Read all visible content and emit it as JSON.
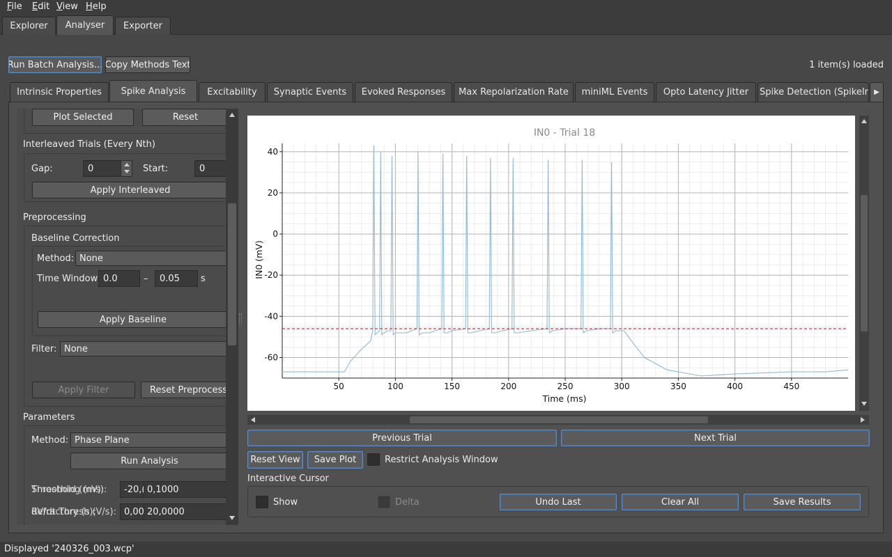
{
  "menu": {
    "items": [
      {
        "label": "File",
        "u": "F",
        "rest": "ile"
      },
      {
        "label": "Edit",
        "u": "E",
        "rest": "dit"
      },
      {
        "label": "View",
        "u": "V",
        "rest": "iew"
      },
      {
        "label": "Help",
        "u": "H",
        "rest": "elp"
      }
    ]
  },
  "top_tabs": [
    "Explorer",
    "Analyser",
    "Exporter"
  ],
  "top_tabs_active": "Analyser",
  "toolbar": {
    "run_batch": "Run Batch Analysis...",
    "copy_methods": "Copy Methods Text",
    "items_loaded": "1 item(s) loaded"
  },
  "sub_tabs": [
    "Intrinsic Properties",
    "Spike Analysis",
    "Excitability",
    "Synaptic Events",
    "Evoked Responses",
    "Max Repolarization Rate",
    "miniML Events",
    "Opto Latency Jitter",
    "Spike Detection (SpikeInt"
  ],
  "sub_tabs_active": "Spike Analysis",
  "left": {
    "plot_selected": "Plot Selected",
    "reset": "Reset",
    "interleaved_title": "Interleaved Trials (Every Nth)",
    "gap_label": "Gap:",
    "gap_value": "0",
    "start_label": "Start:",
    "start_value": "0",
    "apply_interleaved": "Apply Interleaved",
    "preprocessing_title": "Preprocessing",
    "baseline_title": "Baseline Correction",
    "method_label": "Method:",
    "method_value": "None",
    "time_window_label": "Time Window:",
    "tw_start": "0.0",
    "tw_dash": "–",
    "tw_end": "0.05",
    "tw_unit": "s",
    "apply_baseline": "Apply Baseline",
    "filter_label": "Filter:",
    "filter_value": "None",
    "apply_filter": "Apply Filter",
    "reset_preprocessing": "Reset Preprocessi",
    "parameters_title": "Parameters",
    "param_method_label": "Method:",
    "param_method_value": "Phase Plane",
    "run_analysis": "Run Analysis",
    "row1_label_a": "Smoothing (ms):",
    "row1_label_b": "Threshold (mV):",
    "row1_val_a": "-20,(",
    "row1_val_b": "0,1000",
    "row2_label_a": "dV/dt Thresh (V/s):",
    "row2_label_b": "Refractory (s):",
    "row2_val_a": "0,00",
    "row2_val_b": "20,0000"
  },
  "plot": {
    "prev_trial": "Previous Trial",
    "next_trial": "Next Trial",
    "reset_view": "Reset View",
    "save_plot": "Save Plot",
    "restrict_label": "Restrict Analysis Window",
    "cursor_title": "Interactive Cursor",
    "show_label": "Show",
    "delta_label": "Delta",
    "undo_last": "Undo Last",
    "clear_all": "Clear All",
    "save_results": "Save Results"
  },
  "status": {
    "text": "Displayed '240326_003.wcp'"
  },
  "colors": {
    "trace": "#8fb9d6",
    "threshold": "#c62828",
    "accent_focus": "#5a8ccc"
  },
  "chart_data": {
    "type": "line",
    "title": "IN0 - Trial 18",
    "xlabel": "Time (ms)",
    "ylabel": "IN0 (mV)",
    "xlim": [
      0,
      500
    ],
    "ylim": [
      -70,
      44
    ],
    "xticks": [
      50,
      100,
      150,
      200,
      250,
      300,
      350,
      400,
      450
    ],
    "yticks": [
      40,
      20,
      0,
      -20,
      -40,
      -60
    ],
    "grid": true,
    "threshold_line": -46,
    "series": [
      {
        "x": [
          0,
          55,
          60,
          70,
          78,
          80,
          81,
          82,
          84,
          86,
          87,
          88,
          90,
          93,
          96,
          97,
          98,
          100,
          110,
          119,
          120,
          121,
          124,
          130,
          141,
          142,
          143,
          146,
          150,
          162,
          163,
          164,
          167,
          175,
          183,
          184,
          185,
          188,
          195,
          203,
          204,
          205,
          208,
          220,
          234,
          235,
          236,
          239,
          250,
          264,
          265,
          266,
          269,
          280,
          290,
          291,
          292,
          295,
          302,
          310,
          320,
          340,
          370,
          400,
          450,
          480,
          500
        ],
        "y": [
          -67,
          -67,
          -62,
          -56,
          -52,
          -47,
          43,
          -49,
          -48,
          -47,
          40,
          -49,
          -48,
          -47,
          -47,
          38,
          -49,
          -48,
          -48,
          -46,
          40,
          -49,
          -48,
          -48,
          -46,
          39,
          -48,
          -48,
          -47,
          -46,
          38,
          -48,
          -48,
          -47,
          -46,
          37,
          -48,
          -48,
          -47,
          -46,
          37,
          -48,
          -48,
          -47,
          -46,
          36,
          -48,
          -47,
          -46,
          -46,
          36,
          -48,
          -47,
          -46,
          -46,
          35,
          -48,
          -47,
          -47,
          -53,
          -60,
          -66,
          -69,
          -68,
          -67,
          -67,
          -66
        ]
      }
    ]
  }
}
